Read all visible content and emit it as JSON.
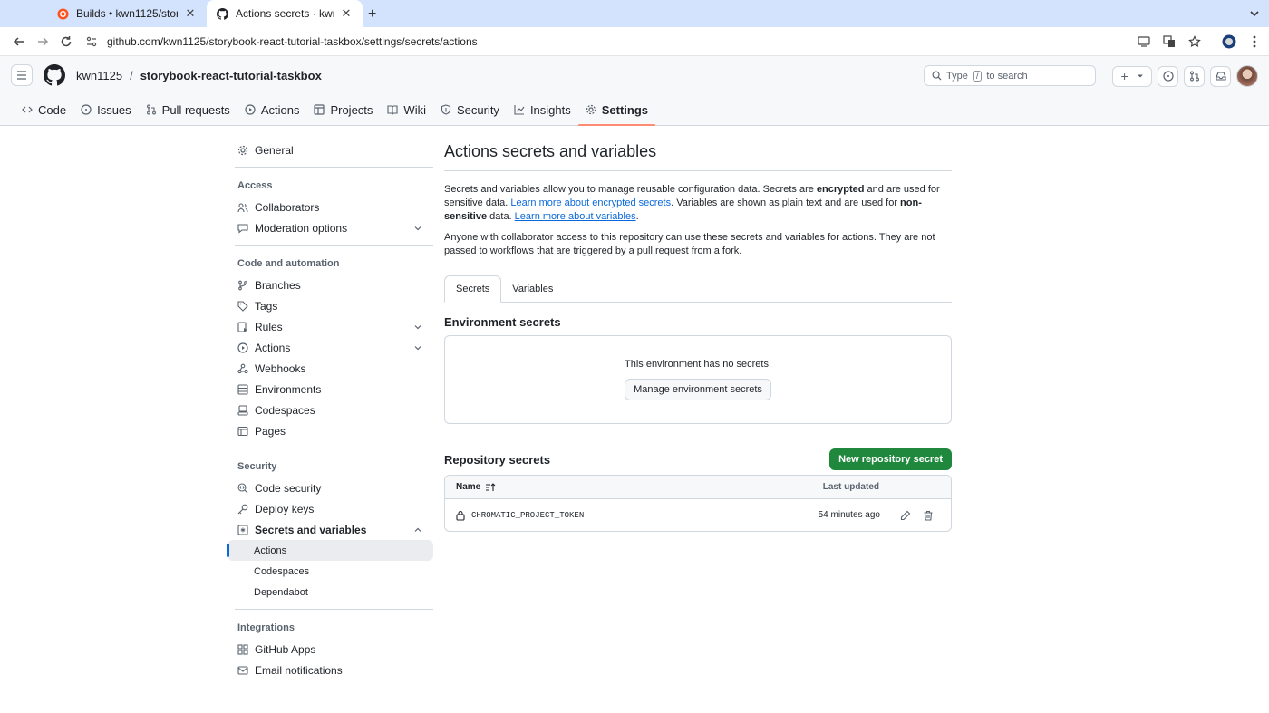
{
  "browser": {
    "tabs": [
      {
        "title": "Builds • kwn1125/storybook-r",
        "active": false
      },
      {
        "title": "Actions secrets · kwn1125/sto",
        "active": true
      }
    ],
    "url": "github.com/kwn1125/storybook-react-tutorial-taskbox/settings/secrets/actions"
  },
  "header": {
    "owner": "kwn1125",
    "separator": "/",
    "repo": "storybook-react-tutorial-taskbox",
    "search_prefix": "Type",
    "search_key": "/",
    "search_suffix": "to search"
  },
  "repo_nav": [
    {
      "label": "Code",
      "icon": "code-icon"
    },
    {
      "label": "Issues",
      "icon": "issue-icon"
    },
    {
      "label": "Pull requests",
      "icon": "pull-request-icon"
    },
    {
      "label": "Actions",
      "icon": "play-icon"
    },
    {
      "label": "Projects",
      "icon": "table-icon"
    },
    {
      "label": "Wiki",
      "icon": "book-icon"
    },
    {
      "label": "Security",
      "icon": "shield-icon"
    },
    {
      "label": "Insights",
      "icon": "graph-icon"
    },
    {
      "label": "Settings",
      "icon": "gear-icon"
    }
  ],
  "sidebar": {
    "general": "General",
    "access_heading": "Access",
    "collaborators": "Collaborators",
    "moderation": "Moderation options",
    "code_heading": "Code and automation",
    "branches": "Branches",
    "tags": "Tags",
    "rules": "Rules",
    "actions": "Actions",
    "webhooks": "Webhooks",
    "environments": "Environments",
    "codespaces": "Codespaces",
    "pages": "Pages",
    "security_heading": "Security",
    "code_security": "Code security",
    "deploy_keys": "Deploy keys",
    "secrets_vars": "Secrets and variables",
    "sub_actions": "Actions",
    "sub_codespaces": "Codespaces",
    "sub_dependabot": "Dependabot",
    "integrations_heading": "Integrations",
    "github_apps": "GitHub Apps",
    "email_notifications": "Email notifications"
  },
  "main": {
    "title": "Actions secrets and variables",
    "p1_a": "Secrets and variables allow you to manage reusable configuration data. Secrets are ",
    "p1_b": "encrypted",
    "p1_c": " and are used for sensitive data. ",
    "p1_link1": "Learn more about encrypted secrets",
    "p1_d": ". Variables are shown as plain text and are used for ",
    "p1_e": "non-sensitive",
    "p1_f": " data. ",
    "p1_link2": "Learn more about variables",
    "p1_g": ".",
    "p2": "Anyone with collaborator access to this repository can use these secrets and variables for actions. They are not passed to workflows that are triggered by a pull request from a fork.",
    "tab_secrets": "Secrets",
    "tab_variables": "Variables",
    "env_heading": "Environment secrets",
    "env_empty": "This environment has no secrets.",
    "env_button": "Manage environment secrets",
    "repo_heading": "Repository secrets",
    "new_button": "New repository secret",
    "col_name": "Name",
    "col_updated": "Last updated",
    "secrets": [
      {
        "name": "CHROMATIC_PROJECT_TOKEN",
        "updated": "54 minutes ago"
      }
    ]
  },
  "colors": {
    "accent": "#0969da",
    "green": "#1f883d",
    "tab_underline": "#fd8c73"
  }
}
